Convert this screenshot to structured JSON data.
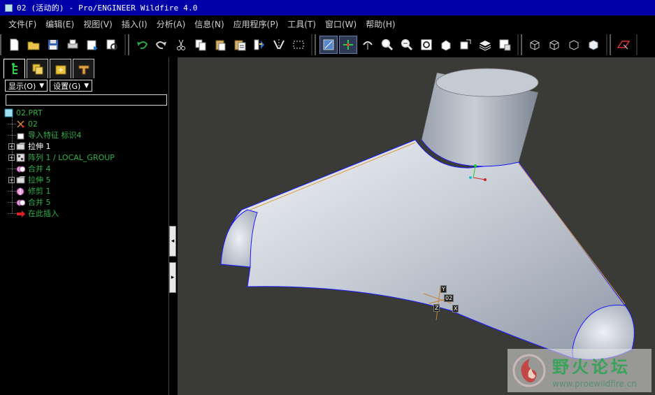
{
  "window": {
    "title": "02 (活动的) - Pro/ENGINEER Wildfire 4.0"
  },
  "menu": [
    "文件(F)",
    "编辑(E)",
    "视图(V)",
    "插入(I)",
    "分析(A)",
    "信息(N)",
    "应用程序(P)",
    "工具(T)",
    "窗口(W)",
    "帮助(H)"
  ],
  "toolbar": {
    "groups": [
      [
        "new-file-icon",
        "open-folder-icon",
        "save-icon",
        "print-icon",
        "send-mail-icon",
        "search-find-icon"
      ],
      [
        "undo-icon",
        "redo-icon",
        "cut-icon",
        "copy-icon",
        "paste-icon",
        "paste-special-icon",
        "regenerate-icon",
        "mirror-icon",
        "select-box-icon"
      ],
      [
        "repaint-icon",
        "spin-center-icon",
        "orient-mode-icon",
        "zoom-in-icon",
        "zoom-out-icon",
        "refit-icon",
        "reorient-icon",
        "saved-views-icon",
        "layers-icon",
        "view-manager-icon"
      ],
      [
        "wireframe-icon",
        "hidden-line-icon",
        "no-hidden-icon",
        "shading-icon"
      ],
      [
        "datum-plane-icon"
      ]
    ],
    "active_buttons": [
      "repaint-icon",
      "spin-center-icon"
    ]
  },
  "left_panel": {
    "tabs": [
      "model-tree-tab-icon",
      "layers-tab-icon",
      "folder-browser-tab-icon",
      "favorites-tab-icon"
    ],
    "dropdowns": {
      "display": "显示(O)",
      "settings": "设置(G)"
    },
    "search_value": "",
    "tree": [
      {
        "label": "02.PRT",
        "icon": "part-icon",
        "color": "#2fb04a",
        "indent": 0,
        "expander": ""
      },
      {
        "label": "02",
        "icon": "coordinate-system-icon",
        "color": "#2fb04a",
        "indent": 1,
        "expander": ""
      },
      {
        "label": "导入特征 标识4",
        "icon": "import-feature-icon",
        "color": "#2fb04a",
        "indent": 1,
        "expander": ""
      },
      {
        "label": "拉伸 1",
        "icon": "extrude-icon",
        "color": "#ffffff",
        "indent": 1,
        "expander": "+"
      },
      {
        "label": "阵列 1 / LOCAL_GROUP",
        "icon": "pattern-icon",
        "color": "#2fb04a",
        "indent": 1,
        "expander": "+"
      },
      {
        "label": "合并 4",
        "icon": "merge-icon",
        "color": "#2fb04a",
        "indent": 1,
        "expander": ""
      },
      {
        "label": "拉伸 5",
        "icon": "extrude-icon",
        "color": "#2fb04a",
        "indent": 1,
        "expander": "+"
      },
      {
        "label": "修剪 1",
        "icon": "trim-icon",
        "color": "#2fb04a",
        "indent": 1,
        "expander": ""
      },
      {
        "label": "合并 5",
        "icon": "merge-icon",
        "color": "#2fb04a",
        "indent": 1,
        "expander": ""
      },
      {
        "label": "在此插入",
        "icon": "insert-here-arrow-icon",
        "color": "#2fb04a",
        "indent": 1,
        "expander": ""
      }
    ]
  },
  "graphics": {
    "background": "#3a3a37",
    "csys_labels": {
      "y": "Y",
      "name": "02",
      "x": "X",
      "z": "Z"
    }
  },
  "watermark": {
    "title": "野火论坛",
    "url": "www.proewildfire.cn"
  }
}
